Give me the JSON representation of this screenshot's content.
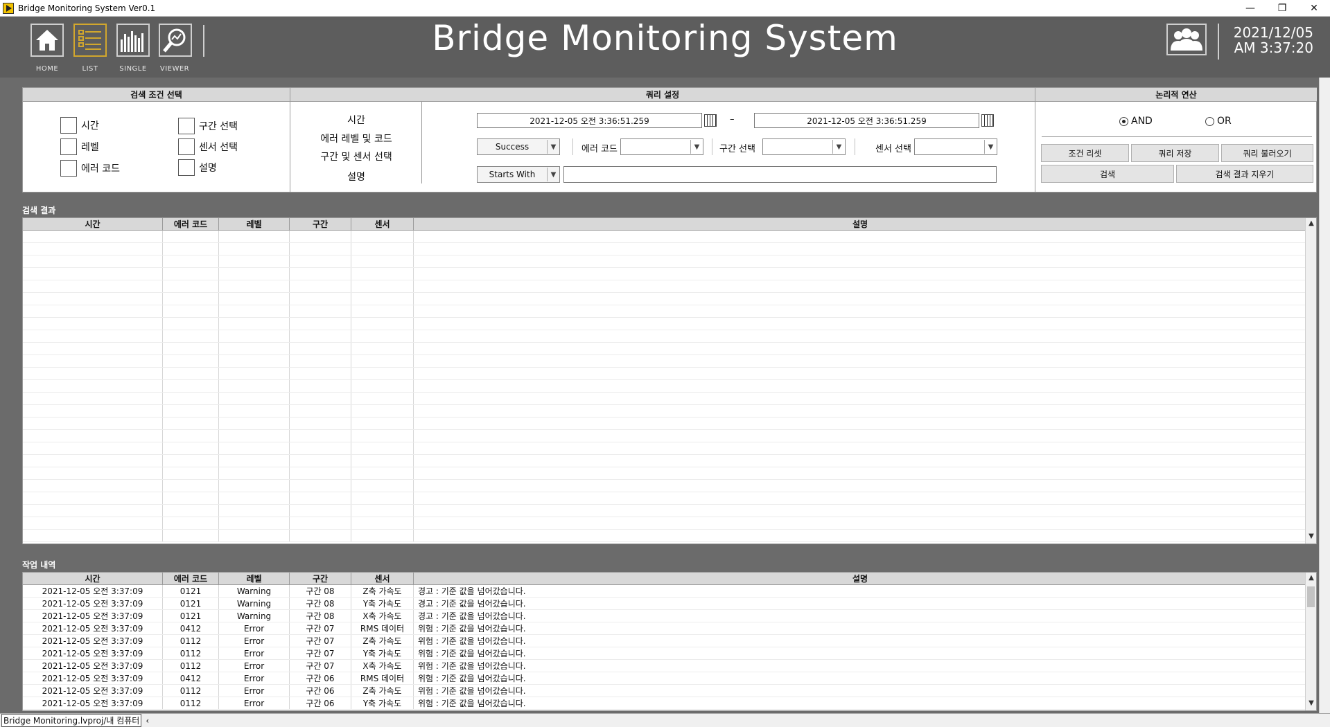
{
  "window": {
    "title": "Bridge Monitoring System Ver0.1",
    "minimize": "—",
    "restore": "❐",
    "close": "✕"
  },
  "header": {
    "title": "Bridge Monitoring System",
    "nav": [
      {
        "label": "HOME",
        "icon": "home-icon"
      },
      {
        "label": "LIST",
        "icon": "list-icon"
      },
      {
        "label": "SINGLE",
        "icon": "bar-chart-icon"
      },
      {
        "label": "VIEWER",
        "icon": "magnifier-icon"
      }
    ],
    "date": "2021/12/05",
    "time": "AM 3:37:20"
  },
  "query_panel": {
    "section_conditions": "검색 조건 선택",
    "section_query": "쿼리 설정",
    "section_logic": "논리적 연산",
    "checkboxes": [
      "시간",
      "레벨",
      "에러 코드",
      "구간 선택",
      "센서 선택",
      "설명"
    ],
    "query_labels": [
      "시간",
      "에러 레벨 및 코드",
      "구간 및 센서 선택",
      "설명"
    ],
    "time_start": "2021-12-05  오전 3:36:51.259",
    "time_end": "2021-12-05  오전 3:36:51.259",
    "range_dash": "–",
    "level_value": "Success",
    "error_code_label": "에러 코드",
    "section_select_label": "구간 선택",
    "sensor_select_label": "센서 선택",
    "desc_mode": "Starts With",
    "logic_and": "AND",
    "logic_or": "OR",
    "buttons": {
      "reset": "조건 리셋",
      "save": "쿼리 저장",
      "load": "쿼리 불러오기",
      "search": "검색",
      "clear": "검색 결과 지우기"
    }
  },
  "results": {
    "label": "검색 결과",
    "columns": [
      "시간",
      "에러 코드",
      "레벨",
      "구간",
      "센서",
      "설명"
    ]
  },
  "log": {
    "label": "작업 내역",
    "columns": [
      "시간",
      "에러 코드",
      "레벨",
      "구간",
      "센서",
      "설명"
    ],
    "rows": [
      [
        "2021-12-05 오전 3:37:09",
        "0121",
        "Warning",
        "구간 08",
        "Z축 가속도",
        "경고 : 기준 값을 넘어갔습니다."
      ],
      [
        "2021-12-05 오전 3:37:09",
        "0121",
        "Warning",
        "구간 08",
        "Y축 가속도",
        "경고 : 기준 값을 넘어갔습니다."
      ],
      [
        "2021-12-05 오전 3:37:09",
        "0121",
        "Warning",
        "구간 08",
        "X축 가속도",
        "경고 : 기준 값을 넘어갔습니다."
      ],
      [
        "2021-12-05 오전 3:37:09",
        "0412",
        "Error",
        "구간 07",
        "RMS 데이터",
        "위험 : 기준 값을 넘어갔습니다."
      ],
      [
        "2021-12-05 오전 3:37:09",
        "0112",
        "Error",
        "구간 07",
        "Z축 가속도",
        "위험 : 기준 값을 넘어갔습니다."
      ],
      [
        "2021-12-05 오전 3:37:09",
        "0112",
        "Error",
        "구간 07",
        "Y축 가속도",
        "위험 : 기준 값을 넘어갔습니다."
      ],
      [
        "2021-12-05 오전 3:37:09",
        "0112",
        "Error",
        "구간 07",
        "X축 가속도",
        "위험 : 기준 값을 넘어갔습니다."
      ],
      [
        "2021-12-05 오전 3:37:09",
        "0412",
        "Error",
        "구간 06",
        "RMS 데이터",
        "위험 : 기준 값을 넘어갔습니다."
      ],
      [
        "2021-12-05 오전 3:37:09",
        "0112",
        "Error",
        "구간 06",
        "Z축 가속도",
        "위험 : 기준 값을 넘어갔습니다."
      ],
      [
        "2021-12-05 오전 3:37:09",
        "0112",
        "Error",
        "구간 06",
        "Y축 가속도",
        "위험 : 기준 값을 넘어갔습니다."
      ]
    ]
  },
  "statusbar": {
    "path": "Bridge Monitoring.lvproj/내 컴퓨터"
  }
}
